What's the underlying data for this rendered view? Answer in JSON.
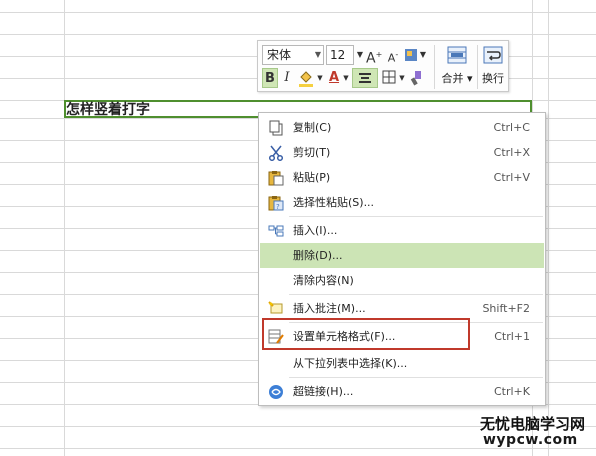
{
  "sheet": {
    "cell_text": "怎样竖着打字"
  },
  "mini_toolbar": {
    "font_name": "宋体",
    "font_size": "12",
    "grow_font": "A",
    "shrink_font": "A",
    "bold": "B",
    "italic": "I",
    "font_color_letter": "A",
    "merge_label": "合并",
    "wrap_label": "换行",
    "merge_icon": "merge-cells-icon",
    "wrap_icon": "wrap-text-icon"
  },
  "context_menu": {
    "items": [
      {
        "label": "复制(C)",
        "shortcut": "Ctrl+C",
        "icon": "copy-icon"
      },
      {
        "label": "剪切(T)",
        "shortcut": "Ctrl+X",
        "icon": "scissors-icon"
      },
      {
        "label": "粘贴(P)",
        "shortcut": "Ctrl+V",
        "icon": "paste-icon"
      },
      {
        "label": "选择性粘贴(S)...",
        "shortcut": "",
        "icon": "paste-special-icon"
      },
      {
        "label": "插入(I)...",
        "shortcut": "",
        "icon": "insert-icon"
      },
      {
        "label": "删除(D)...",
        "shortcut": "",
        "icon": ""
      },
      {
        "label": "清除内容(N)",
        "shortcut": "",
        "icon": ""
      },
      {
        "label": "插入批注(M)...",
        "shortcut": "Shift+F2",
        "icon": "comment-icon"
      },
      {
        "label": "设置单元格格式(F)...",
        "shortcut": "Ctrl+1",
        "icon": "format-cells-icon"
      },
      {
        "label": "从下拉列表中选择(K)...",
        "shortcut": "",
        "icon": ""
      },
      {
        "label": "超链接(H)...",
        "shortcut": "Ctrl+K",
        "icon": "hyperlink-icon"
      }
    ]
  },
  "watermark": {
    "title": "无忧电脑学习网",
    "url": "wypcw.com"
  },
  "colors": {
    "selection_border": "#4f8f2f",
    "menu_highlight": "#cce4b5",
    "annotation_red": "#c0392b"
  }
}
